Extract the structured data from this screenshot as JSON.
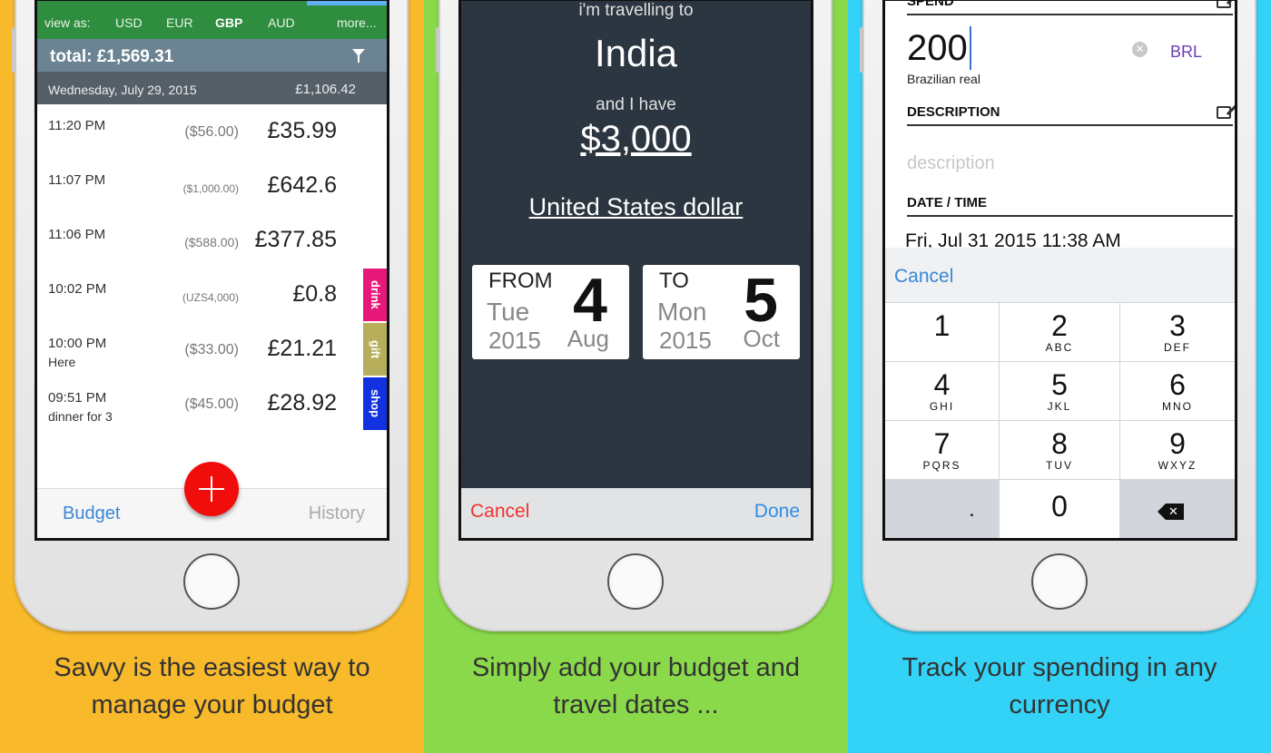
{
  "panel1": {
    "currency_bar": {
      "label": "view as:",
      "options": [
        "USD",
        "EUR",
        "GBP",
        "AUD"
      ],
      "selected": "GBP",
      "more": "more..."
    },
    "total": "total:  £1,569.31",
    "day_header": {
      "date": "Wednesday, July 29, 2015",
      "amount": "£1,106.42"
    },
    "transactions": [
      {
        "time": "11:20 PM",
        "note": "",
        "original": "($56.00)",
        "amount": "£35.99",
        "tag": ""
      },
      {
        "time": "11:07 PM",
        "note": "",
        "original": "($1,000.00)",
        "amount": "£642.6",
        "tag": ""
      },
      {
        "time": "11:06 PM",
        "note": "",
        "original": "($588.00)",
        "amount": "£377.85",
        "tag": ""
      },
      {
        "time": "10:02 PM",
        "note": "",
        "original": "(UZS4,000)",
        "amount": "£0.8",
        "tag": "drink"
      },
      {
        "time": "10:00 PM",
        "note": "Here",
        "original": "($33.00)",
        "amount": "£21.21",
        "tag": "gift"
      },
      {
        "time": "09:51 PM",
        "note": "dinner for 3",
        "original": "($45.00)",
        "amount": "£28.92",
        "tag": "shop"
      }
    ],
    "tabbar": {
      "budget": "Budget",
      "history": "History"
    },
    "caption": [
      "Savvy is the easiest way to",
      "manage your budget"
    ]
  },
  "panel2": {
    "travel_label": "i'm travelling to",
    "destination": "India",
    "have_label": "and I have",
    "budget_amount": "$3,000",
    "currency": "United States dollar",
    "from": {
      "label": "FROM",
      "weekday": "Tue",
      "year": "2015",
      "day": "4",
      "month": "Aug"
    },
    "to": {
      "label": "TO",
      "weekday": "Mon",
      "year": "2015",
      "day": "5",
      "month": "Oct"
    },
    "cancel": "Cancel",
    "done": "Done",
    "caption": [
      "Simply add your budget and",
      "travel dates ..."
    ]
  },
  "panel3": {
    "spend_label": "SPEND",
    "amount_value": "200",
    "currency_code": "BRL",
    "currency_name": "Brazilian real",
    "description_label": "DESCRIPTION",
    "description_placeholder": "description",
    "datetime_label": "DATE / TIME",
    "datetime_value": "Fri, Jul 31 2015 11:38 AM",
    "keyboard_cancel": "Cancel",
    "keys": [
      {
        "n": "1",
        "l": ""
      },
      {
        "n": "2",
        "l": "ABC"
      },
      {
        "n": "3",
        "l": "DEF"
      },
      {
        "n": "4",
        "l": "GHI"
      },
      {
        "n": "5",
        "l": "JKL"
      },
      {
        "n": "6",
        "l": "MNO"
      },
      {
        "n": "7",
        "l": "PQRS"
      },
      {
        "n": "8",
        "l": "TUV"
      },
      {
        "n": "9",
        "l": "WXYZ"
      }
    ],
    "decimal_key": ".",
    "zero_key": "0",
    "caption": [
      "Track your spending in any",
      "currency"
    ]
  },
  "colors": {
    "panel1_bg": "#f8b92a",
    "panel2_bg": "#8ad94a",
    "panel3_bg": "#33d3f7",
    "fab": "#f20d0d",
    "tag_drink": "#e6197a",
    "tag_gift": "#b7ae5b",
    "tag_shop": "#1232e0"
  }
}
